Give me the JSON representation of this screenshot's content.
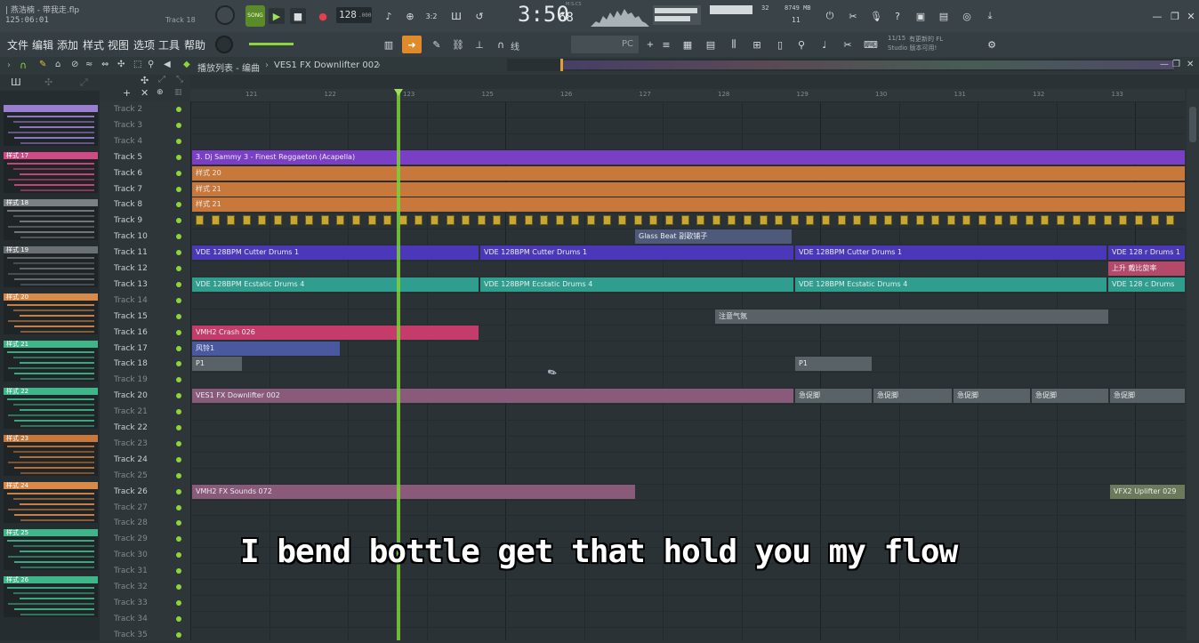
{
  "project": {
    "title": "|  燕浩楠 - 带我走.flp",
    "time_code": "125:06:01",
    "track_label": "Track 18"
  },
  "transport": {
    "mode": "SONG",
    "tempo": "128",
    "tempo_dec": ".000",
    "time": "3:50",
    "time_sub": "68",
    "time_unit": "M:S:CS",
    "cpu": "32",
    "memory": "8749 MB",
    "voices": "11"
  },
  "menu": {
    "file": "文件",
    "edit": "编辑",
    "add": "添加",
    "patterns": "样式",
    "view": "视图",
    "options": "选项",
    "tools": "工具",
    "help": "帮助"
  },
  "tools": {
    "snap": "线",
    "pattern_name": "PC",
    "news_counter": "11/15",
    "news_line1": "有更新的 FL",
    "news_line2": "Studio 版本可用!"
  },
  "breadcrumb": {
    "location": "播放列表 - 编曲",
    "clip": "VES1 FX Downlifter 002"
  },
  "ruler": [
    {
      "label": "121"
    },
    {
      "label": "122"
    },
    {
      "label": "123"
    },
    {
      "label": "125"
    },
    {
      "label": "126"
    },
    {
      "label": "127"
    },
    {
      "label": "128"
    },
    {
      "label": "129"
    },
    {
      "label": "130"
    },
    {
      "label": "131"
    },
    {
      "label": "132"
    },
    {
      "label": "133"
    }
  ],
  "tracks": [
    {
      "name": "Track 2"
    },
    {
      "name": "Track 3"
    },
    {
      "name": "Track 4"
    },
    {
      "name": "Track 5"
    },
    {
      "name": "Track 6"
    },
    {
      "name": "Track 7"
    },
    {
      "name": "Track 8"
    },
    {
      "name": "Track 9"
    },
    {
      "name": "Track 10"
    },
    {
      "name": "Track 11"
    },
    {
      "name": "Track 12"
    },
    {
      "name": "Track 13"
    },
    {
      "name": "Track 14"
    },
    {
      "name": "Track 15"
    },
    {
      "name": "Track 16"
    },
    {
      "name": "Track 17"
    },
    {
      "name": "Track 18"
    },
    {
      "name": "Track 19"
    },
    {
      "name": "Track 20"
    },
    {
      "name": "Track 21"
    },
    {
      "name": "Track 22"
    },
    {
      "name": "Track 23"
    },
    {
      "name": "Track 24"
    },
    {
      "name": "Track 25"
    },
    {
      "name": "Track 26"
    },
    {
      "name": "Track 27"
    },
    {
      "name": "Track 28"
    },
    {
      "name": "Track 29"
    },
    {
      "name": "Track 30"
    },
    {
      "name": "Track 31"
    },
    {
      "name": "Track 32"
    },
    {
      "name": "Track 33"
    },
    {
      "name": "Track 34"
    },
    {
      "name": "Track 35"
    }
  ],
  "patterns": [
    {
      "label": "",
      "color": "#9a7fd1"
    },
    {
      "label": "样式 17",
      "color": "#d04a86"
    },
    {
      "label": "样式 18",
      "color": "#7a8084"
    },
    {
      "label": "样式 19",
      "color": "#6a7074"
    },
    {
      "label": "样式 20",
      "color": "#d88a4a"
    },
    {
      "label": "样式 21",
      "color": "#3fb58a"
    },
    {
      "label": "样式 22",
      "color": "#3fb58a"
    },
    {
      "label": "样式 23",
      "color": "#c8783a"
    },
    {
      "label": "样式 24",
      "color": "#d88a4a"
    },
    {
      "label": "样式 25",
      "color": "#3fb58a"
    },
    {
      "label": "样式 26",
      "color": "#3fb58a"
    }
  ],
  "clips": {
    "c1": "3. Dj Sammy 3 - Finest Reggaeton (Acapella)",
    "c2": "样式 20",
    "c3": "样式 21",
    "c4": "样式 21",
    "c5": "Glass Beat  副歌铺子",
    "c6": "VDE 128BPM Cutter Drums 1",
    "c7": "VDE 128BPM Cutter Drums 1",
    "c8": "VDE 128BPM Cutter Drums 1",
    "c9": "VDE 128 r Drums 1",
    "c10": "上升  戴比旋率",
    "c11": "VDE 128BPM Ecstatic Drums 4",
    "c12": "VDE 128BPM Ecstatic Drums 4",
    "c13": "VDE 128BPM Ecstatic Drums 4",
    "c14": "VDE 128 c Drums",
    "c15": "注意气氛",
    "c16": "VMH2 Crash 026",
    "c17": "风铃1",
    "c18": "P1",
    "c19": "P1",
    "c20": "VES1 FX Downlifter 002",
    "c21": "急促脚",
    "c22": "急促脚",
    "c23": "急促脚",
    "c24": "急促脚",
    "c25": "急促脚",
    "c26": "VMH2 FX Sounds 072",
    "c27": "VFX2 Uplifter 029"
  },
  "subtitle": "I bend bottle get that hold you my flow",
  "colors": {
    "purple": "#7a3fc4",
    "orange": "#c8783a",
    "indigo": "#4a38b8",
    "teal": "#2f9e8e",
    "pink": "#c43d6a",
    "gray": "#596266",
    "mauve": "#8a5a7a",
    "green": "#8fd43a",
    "playhead": "#7bd13a"
  }
}
